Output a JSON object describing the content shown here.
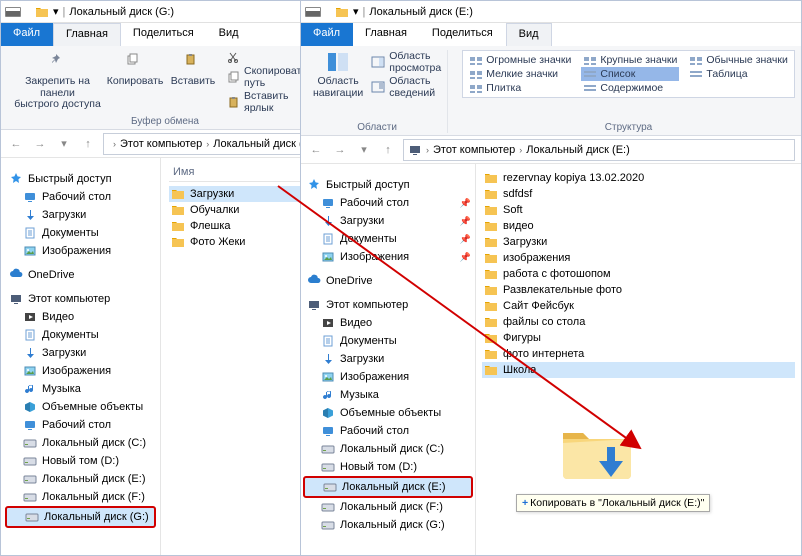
{
  "left": {
    "title": "Локальный диск (G:)",
    "tabs": {
      "file": "Файл",
      "home": "Главная",
      "share": "Поделиться",
      "view": "Вид"
    },
    "ribbon": {
      "pin": "Закрепить на панели\nбыстрого доступа",
      "copy": "Копировать",
      "paste": "Вставить",
      "copy_path": "Скопировать путь",
      "paste_shortcut": "Вставить ярлык",
      "group": "Буфер обмена"
    },
    "breadcrumb": {
      "pc": "Этот компьютер",
      "drive": "Локальный диск (G:)"
    },
    "col_name": "Имя",
    "files": [
      {
        "label": "Загрузки",
        "selected": true
      },
      {
        "label": "Обучалки"
      },
      {
        "label": "Флешка"
      },
      {
        "label": "Фото Жеки"
      }
    ],
    "tree": {
      "quick": "Быстрый доступ",
      "desktop": "Рабочий стол",
      "downloads": "Загрузки",
      "documents": "Документы",
      "pictures": "Изображения",
      "onedrive": "OneDrive",
      "thispc": "Этот компьютер",
      "video": "Видео",
      "documents2": "Документы",
      "downloads2": "Загрузки",
      "pictures2": "Изображения",
      "music": "Музыка",
      "objects3d": "Объемные объекты",
      "desktop2": "Рабочий стол",
      "drive_c": "Локальный диск (C:)",
      "drive_d": "Новый том (D:)",
      "drive_e": "Локальный диск (E:)",
      "drive_f": "Локальный диск (F:)",
      "drive_g": "Локальный диск (G:)"
    }
  },
  "right": {
    "title": "Локальный диск (E:)",
    "tabs": {
      "file": "Файл",
      "home": "Главная",
      "share": "Поделиться",
      "view": "Вид"
    },
    "ribbon": {
      "nav_pane": "Область навигации",
      "preview": "Область просмотра",
      "details": "Область сведений",
      "group_areas": "Области",
      "views": {
        "huge": "Огромные значки",
        "large": "Крупные значки",
        "regular": "Обычные значки",
        "small": "Мелкие значки",
        "list": "Список",
        "table": "Таблица",
        "tiles": "Плитка",
        "content": "Содержимое"
      },
      "group_layout": "Структура"
    },
    "breadcrumb": {
      "pc": "Этот компьютер",
      "drive": "Локальный диск (E:)"
    },
    "tree": {
      "quick": "Быстрый доступ",
      "desktop": "Рабочий стол",
      "downloads": "Загрузки",
      "documents": "Документы",
      "pictures": "Изображения",
      "onedrive": "OneDrive",
      "thispc": "Этот компьютер",
      "video": "Видео",
      "documents2": "Документы",
      "downloads2": "Загрузки",
      "pictures2": "Изображения",
      "music": "Музыка",
      "objects3d": "Объемные объекты",
      "desktop2": "Рабочий стол",
      "drive_c": "Локальный диск (C:)",
      "drive_d": "Новый том (D:)",
      "drive_e": "Локальный диск (E:)",
      "drive_f": "Локальный диск (F:)",
      "drive_g": "Локальный диск (G:)"
    },
    "files": [
      "rezervnay kopiya 13.02.2020",
      "sdfdsf",
      "Soft",
      "видео",
      "Загрузки",
      "изображения",
      "работа с фотошопом",
      "Развлекательные фото",
      "Сайт Фейсбук",
      "файлы со стола",
      "Фигуры",
      "фото интернета",
      "Школа"
    ],
    "selected_file": "Школа",
    "drag_tooltip": "Копировать в \"Локальный диск (E:)\""
  }
}
